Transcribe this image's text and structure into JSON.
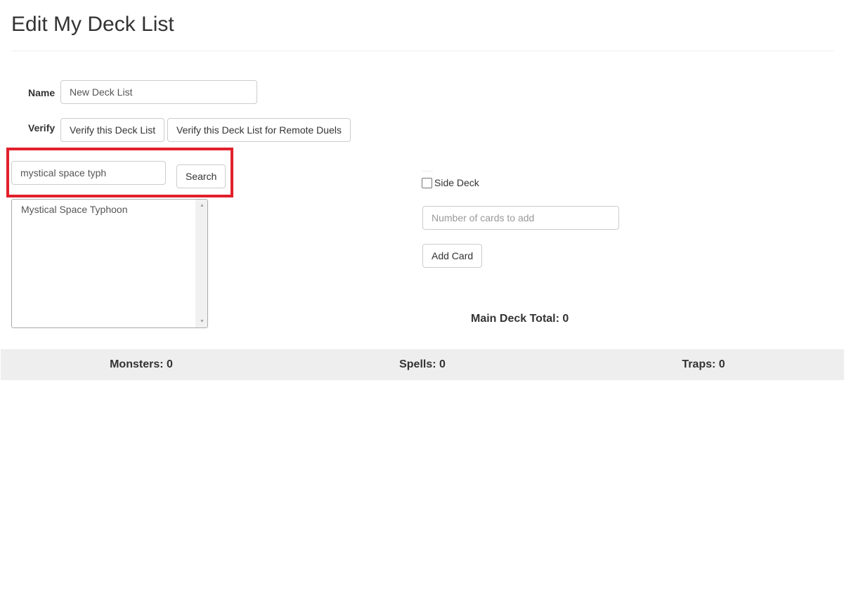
{
  "header": {
    "title": "Edit My Deck List"
  },
  "form": {
    "name_label": "Name",
    "name_value": "New Deck List",
    "verify_label": "Verify",
    "verify_button": "Verify this Deck List",
    "verify_remote_button": "Verify this Deck List for Remote Duels"
  },
  "search": {
    "value": "mystical space typh",
    "button": "Search",
    "results": [
      "Mystical Space Typhoon"
    ]
  },
  "add_panel": {
    "side_deck_label": "Side Deck",
    "side_deck_checked": false,
    "count_placeholder": "Number of cards to add",
    "add_button": "Add Card",
    "main_total": "Main Deck Total: 0"
  },
  "stats": {
    "monsters": "Monsters: 0",
    "spells": "Spells: 0",
    "traps": "Traps: 0"
  },
  "colors": {
    "highlight": "#e1202b",
    "stats_bg": "#eeeeee"
  }
}
